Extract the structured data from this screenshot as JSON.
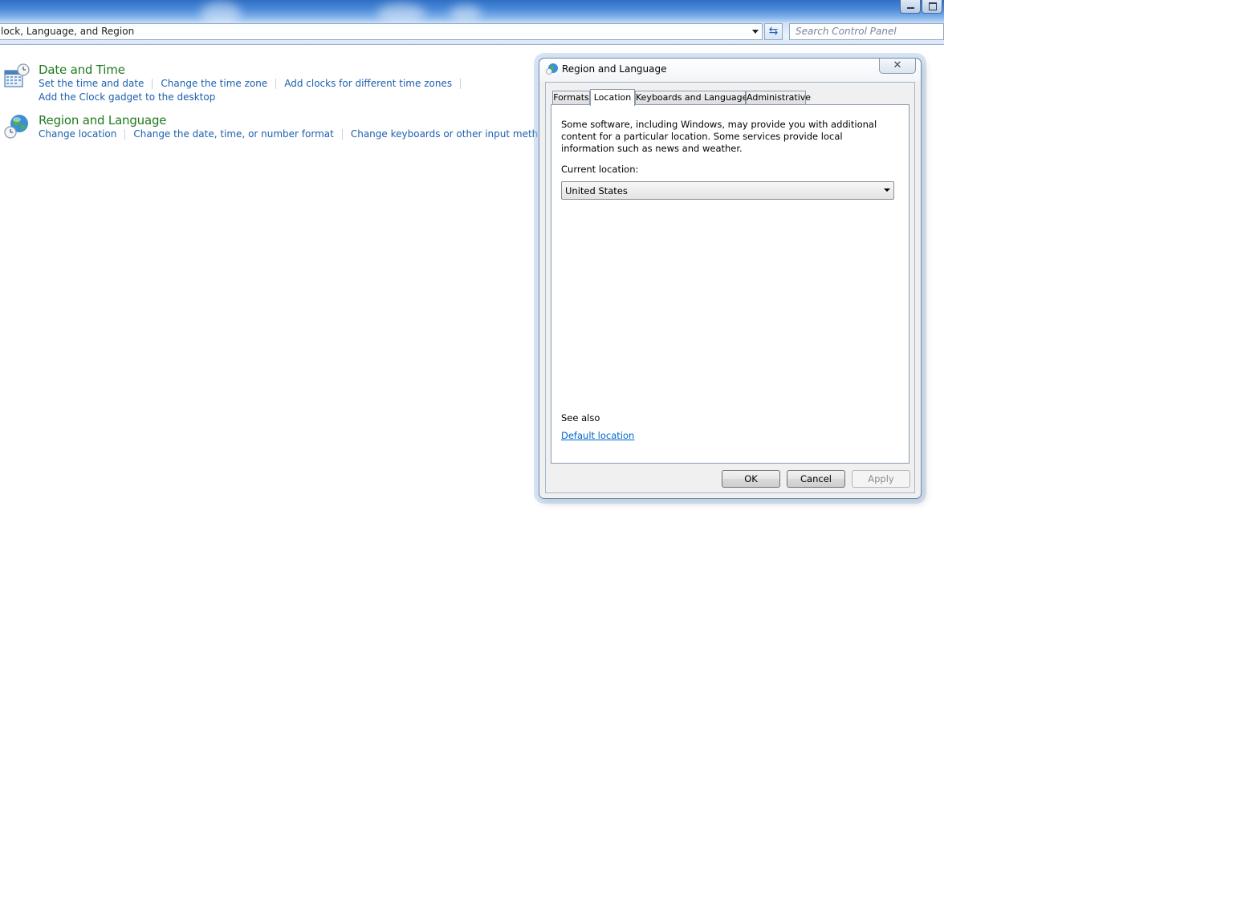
{
  "explorer": {
    "address_text": "lock, Language, and Region",
    "search_placeholder": "Search Control Panel"
  },
  "categories": [
    {
      "title": "Date and Time",
      "icon": "calendar-clock-icon",
      "links": [
        "Set the time and date",
        "Change the time zone",
        "Add clocks for different time zones"
      ],
      "links_row2": [
        "Add the Clock gadget to the desktop"
      ]
    },
    {
      "title": "Region and Language",
      "icon": "globe-clock-icon",
      "links": [
        "Change location",
        "Change the date, time, or number format",
        "Change keyboards or other input methods"
      ]
    }
  ],
  "dialog": {
    "title": "Region and Language",
    "close_glyph": "✕",
    "tabs": [
      "Formats",
      "Location",
      "Keyboards and Languages",
      "Administrative"
    ],
    "active_tab": "Location",
    "description": "Some software, including Windows, may provide you with additional content for a particular location. Some services provide local information such as news and weather.",
    "current_location_label": "Current location:",
    "current_location_value": "United States",
    "see_also_label": "See also",
    "default_location_link": "Default location",
    "buttons": {
      "ok": "OK",
      "cancel": "Cancel",
      "apply": "Apply"
    }
  },
  "colors": {
    "category_title": "#1e7a1e",
    "link": "#1d5fae",
    "dialog_link": "#0066cc"
  }
}
